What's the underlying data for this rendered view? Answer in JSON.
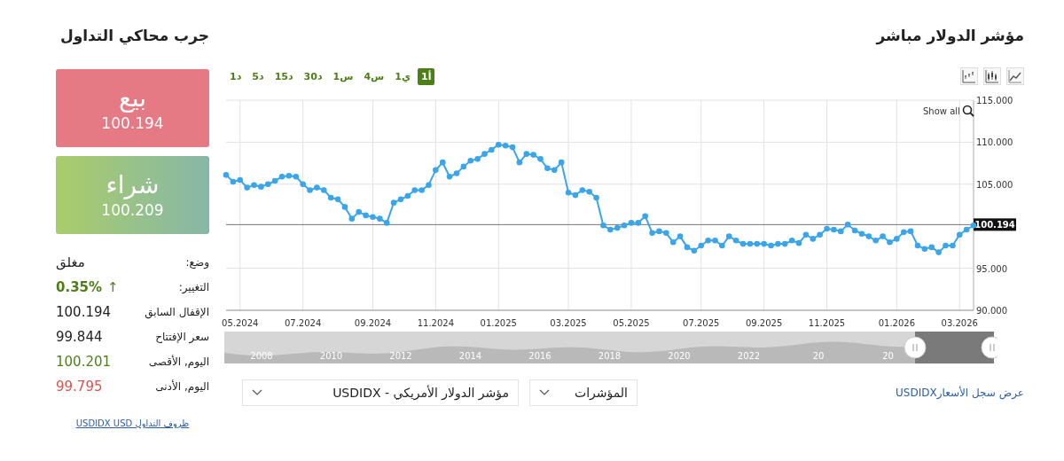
{
  "title": "مؤشر الدولار مباشر",
  "simulator_title": "جرب محاكي التداول",
  "sell": {
    "label": "بيع",
    "price": "100.194"
  },
  "buy": {
    "label": "شراء",
    "price": "100.209"
  },
  "stats": [
    {
      "label": "وضع:",
      "value": "مغلق",
      "color": "#222222"
    },
    {
      "label": "التغيير:",
      "value": "0.35%",
      "icon": "↑",
      "color": "#4d7f17"
    },
    {
      "label": "الإقفال السابق",
      "value": "100.194",
      "color": "#222222"
    },
    {
      "label": "سعر الإفتتاح",
      "value": "99.844",
      "color": "#222222"
    },
    {
      "label": "اليوم, الأقصى",
      "value": "100.201",
      "color": "#4d7f17"
    },
    {
      "label": "اليوم, الأدنى",
      "value": "99.795",
      "color": "#d9534f"
    }
  ],
  "trading_conditions_link": "ظروف التداول USDIDX USD",
  "chart_types": [
    {
      "kind": "line"
    },
    {
      "kind": "candles"
    },
    {
      "kind": "bars"
    }
  ],
  "timeframes": [
    {
      "label": "1أ",
      "selected": true
    },
    {
      "label": "1ي",
      "selected": false
    },
    {
      "label": "4س",
      "selected": false
    },
    {
      "label": "1س",
      "selected": false
    },
    {
      "label": "30د",
      "selected": false
    },
    {
      "label": "15د",
      "selected": false
    },
    {
      "label": "5د",
      "selected": false
    },
    {
      "label": "1د",
      "selected": false
    }
  ],
  "chart": {
    "show_all": "Show all",
    "chart_data": {
      "type": "line",
      "grid": true,
      "categories": [
        null,
        null,
        "05.2024",
        null,
        null,
        null,
        null,
        null,
        null,
        null,
        null,
        "07.2024",
        null,
        null,
        null,
        null,
        null,
        null,
        null,
        null,
        null,
        "09.2024",
        null,
        null,
        null,
        null,
        null,
        null,
        null,
        null,
        "11.2024",
        null,
        null,
        null,
        null,
        null,
        null,
        null,
        null,
        "01.2025",
        null,
        null,
        null,
        null,
        null,
        null,
        null,
        null,
        null,
        "03.2025",
        null,
        null,
        null,
        null,
        null,
        null,
        null,
        null,
        "05.2025",
        null,
        null,
        null,
        null,
        null,
        null,
        null,
        null,
        null,
        "07.2025",
        null,
        null,
        null,
        null,
        null,
        null,
        null,
        null,
        "09.2025",
        null,
        null,
        null,
        null,
        null,
        null,
        null,
        null,
        "11.2025",
        null,
        null,
        null,
        null,
        null,
        null,
        null,
        null,
        null,
        "01.2026",
        null,
        null,
        null,
        null,
        null,
        null,
        null,
        null,
        "03.2026",
        null,
        null
      ],
      "ylim": [
        90,
        115
      ],
      "yticks": [
        {
          "value": 90,
          "label": "90.000"
        },
        {
          "value": 95,
          "label": "95.000"
        },
        {
          "value": 105,
          "label": "105.000"
        },
        {
          "value": 110,
          "label": "110.000"
        },
        {
          "value": 115,
          "label": "115.000"
        }
      ],
      "series": [
        {
          "color": "#3aa5e8",
          "marker": "circle",
          "values": [
            106.1,
            105.3,
            105.5,
            104.6,
            104.9,
            104.7,
            105.0,
            105.4,
            105.9,
            106.0,
            105.9,
            105.0,
            104.3,
            104.6,
            104.3,
            103.4,
            103.2,
            102.3,
            100.9,
            101.7,
            101.3,
            101.1,
            100.9,
            100.4,
            102.8,
            103.2,
            103.6,
            104.3,
            104.3,
            104.9,
            106.7,
            107.6,
            105.9,
            106.3,
            107.1,
            107.8,
            108.0,
            108.6,
            109.1,
            109.7,
            109.6,
            109.4,
            107.6,
            108.6,
            108.5,
            108.0,
            106.9,
            106.7,
            107.6,
            104.0,
            103.7,
            104.3,
            104.1,
            103.4,
            100.1,
            99.6,
            99.8,
            100.1,
            100.4,
            100.4,
            101.2,
            99.2,
            99.4,
            99.2,
            98.1,
            98.8,
            97.5,
            97.1,
            97.7,
            98.3,
            98.3,
            97.7,
            98.8,
            98.3,
            97.9,
            97.9,
            97.9,
            97.9,
            97.7,
            97.9,
            97.9,
            98.3,
            98.0,
            99.0,
            98.5,
            99.0,
            99.7,
            99.6,
            99.4,
            100.2,
            99.5,
            99.1,
            98.8,
            98.3,
            98.8,
            98.1,
            98.5,
            99.3,
            99.4,
            97.7,
            97.3,
            97.5,
            96.9,
            97.7,
            97.7,
            99.0,
            99.6,
            100.1
          ]
        }
      ],
      "ref_lines": [
        {
          "axis": "y",
          "value": 100.194,
          "label": "100.194"
        }
      ]
    }
  },
  "navigator": {
    "years": [
      "20",
      "20",
      "2022",
      "2020",
      "2018",
      "2016",
      "2014",
      "2012",
      "2010",
      "2008"
    ]
  },
  "instrument_select": {
    "value": "مؤشر الدولار الأمريكي - USDIDX"
  },
  "category_select": {
    "value": "المؤشرات"
  },
  "history_link": "عرض سجل الأسعارUSDIDX"
}
